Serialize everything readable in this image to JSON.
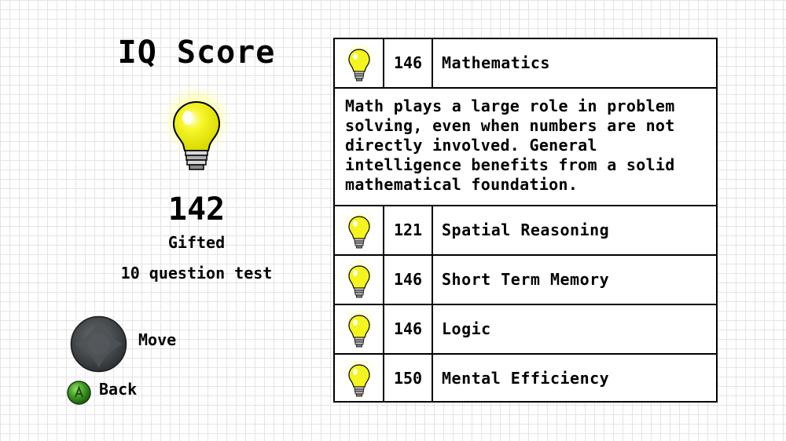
{
  "summary": {
    "title": "IQ Score",
    "score": "142",
    "rating": "Gifted",
    "test_length": "10 question test",
    "bulb_icon": "lightbulb-icon"
  },
  "controls": {
    "move_label": "Move",
    "back_label": "Back",
    "move_icon": "thumbstick-icon",
    "back_icon": "a-button-icon"
  },
  "categories": [
    {
      "score": "146",
      "name": "Mathematics",
      "icon": "lightbulb-icon"
    },
    {
      "score": "121",
      "name": "Spatial Reasoning",
      "icon": "lightbulb-icon"
    },
    {
      "score": "146",
      "name": "Short Term Memory",
      "icon": "lightbulb-icon"
    },
    {
      "score": "146",
      "name": "Logic",
      "icon": "lightbulb-icon"
    },
    {
      "score": "150",
      "name": "Mental Efficiency",
      "icon": "lightbulb-icon"
    }
  ],
  "selected_description": "Math plays a large role in problem solving, even when numbers are not directly involved. General intelligence benefits from a solid mathematical foundation.",
  "colors": {
    "bulb_yellow": "#f2f21a",
    "glow": "#ffff80",
    "button_green": "#3c9a22",
    "stick_gray": "#45494d"
  }
}
